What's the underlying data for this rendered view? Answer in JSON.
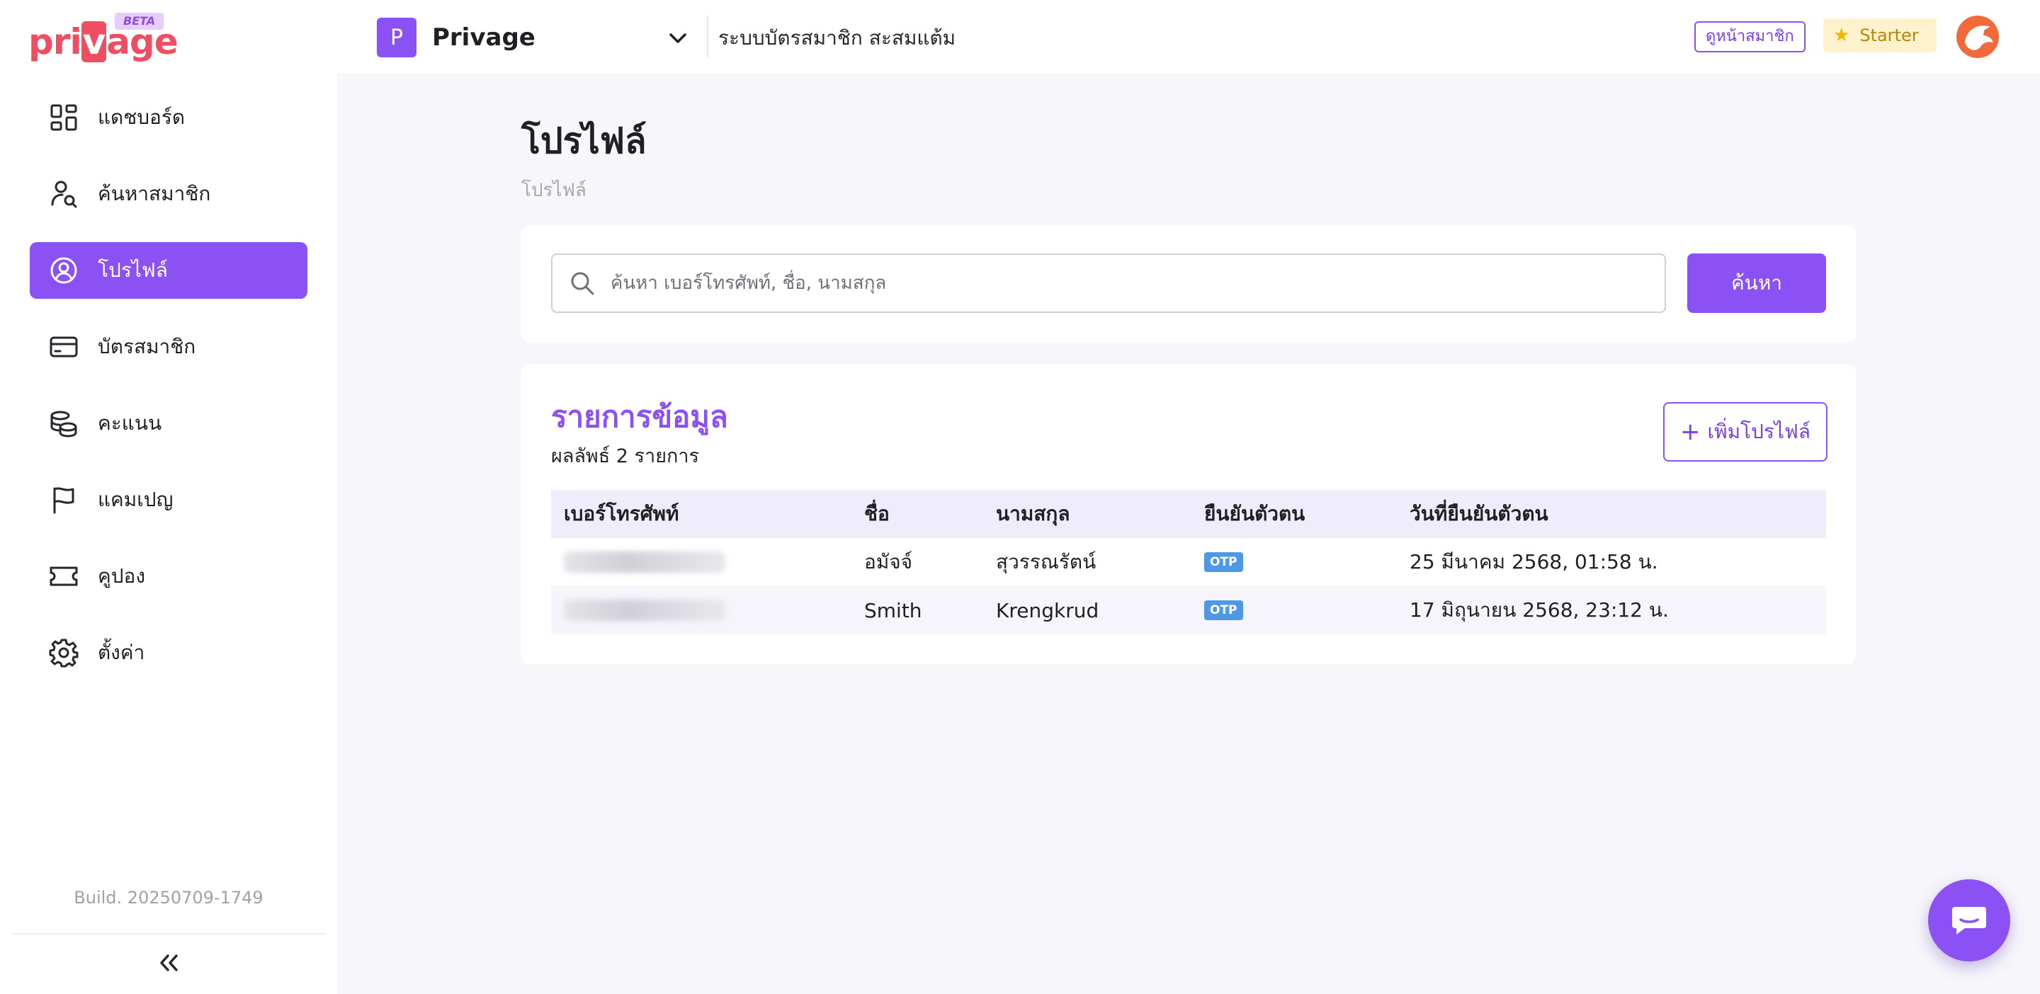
{
  "brand": {
    "logo_text": "privage",
    "beta_label": "BETA",
    "accent_color": "#8b51f5"
  },
  "header": {
    "project_initial": "P",
    "project_name": "Privage",
    "subtitle": "ระบบบัตรสมาชิก สะสมแต้ม",
    "view_member_label": "ดูหน้าสมาชิก",
    "plan_label": "Starter"
  },
  "sidebar": {
    "items": [
      {
        "label": "แดชบอร์ด",
        "icon": "dashboard-icon"
      },
      {
        "label": "ค้นหาสมาชิก",
        "icon": "member-search-icon"
      },
      {
        "label": "โปรไฟล์",
        "icon": "profile-icon",
        "active": true
      },
      {
        "label": "บัตรสมาชิก",
        "icon": "card-icon"
      },
      {
        "label": "คะแนน",
        "icon": "coins-icon"
      },
      {
        "label": "แคมเปญ",
        "icon": "flag-icon"
      },
      {
        "label": "คูปอง",
        "icon": "ticket-icon"
      },
      {
        "label": "ตั้งค่า",
        "icon": "gear-icon"
      }
    ],
    "build": "Build. 20250709-1749"
  },
  "main": {
    "title": "โปรไฟล์",
    "breadcrumb": "โปรไฟล์",
    "search": {
      "placeholder": "ค้นหา เบอร์โทรศัพท์, ชื่อ, นามสกุล",
      "value": "",
      "button_label": "ค้นหา"
    },
    "list": {
      "title": "รายการข้อมูล",
      "count_text": "ผลลัพธ์ 2 รายการ",
      "add_label": "เพิ่มโปรไฟล์",
      "columns": [
        "เบอร์โทรศัพท์",
        "ชื่อ",
        "นามสกุล",
        "ยืนยันตัวตน",
        "วันที่ยืนยันตัวตน"
      ],
      "rows": [
        {
          "first_name": "อมัจจ์",
          "last_name": "สุวรรณรัตน์",
          "verified": "OTP",
          "verified_at": "25 มีนาคม 2568, 01:58 น."
        },
        {
          "first_name": "Smith",
          "last_name": "Krengkrud",
          "verified": "OTP",
          "verified_at": "17 มิถุนายน 2568, 23:12 น."
        }
      ]
    }
  }
}
